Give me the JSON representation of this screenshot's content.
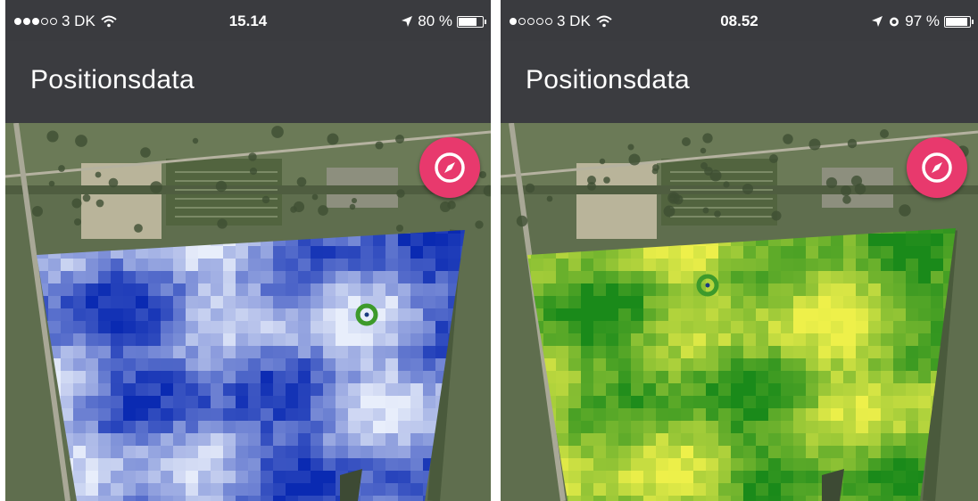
{
  "screens": [
    {
      "status": {
        "carrier": "3 DK",
        "signal_dots": 3,
        "time": "15.14",
        "battery": "80 %",
        "battery_level": 0.8,
        "icons": [
          "location-arrow-icon"
        ]
      },
      "app_bar": {
        "title": "Positionsdata"
      },
      "map": {
        "overlay": "blue-heatmap",
        "colors": {
          "dark": "#0a2ab2",
          "light": "#e8eefb"
        }
      }
    },
    {
      "status": {
        "carrier": "3 DK",
        "signal_dots": 1,
        "time": "08.52",
        "battery": "97 %",
        "battery_level": 0.97,
        "icons": [
          "location-arrow-icon",
          "alarm-icon"
        ]
      },
      "app_bar": {
        "title": "Positionsdata"
      },
      "map": {
        "overlay": "green-yellow-heatmap",
        "colors": {
          "dark": "#1a8a1a",
          "light": "#eef04a"
        }
      }
    }
  ],
  "fab": {
    "icon": "compass-icon",
    "color": "#e8396d"
  },
  "marker_color": "#3d9a2b"
}
